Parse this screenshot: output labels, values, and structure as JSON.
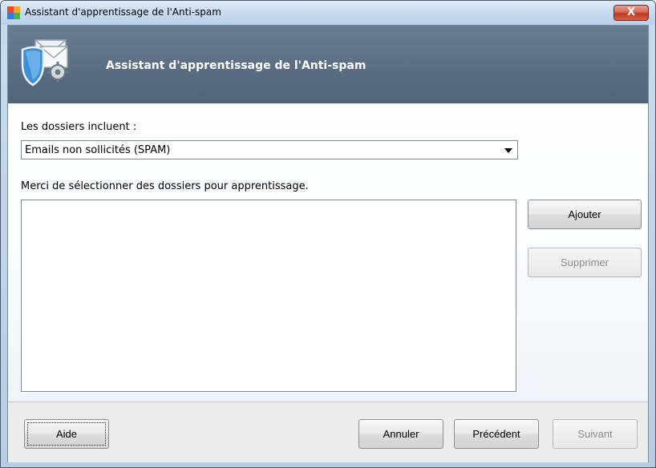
{
  "window": {
    "title": "Assistant d'apprentissage de l'Anti-spam",
    "close_label": "X"
  },
  "banner": {
    "title": "Assistant d'apprentissage de l'Anti-spam",
    "icon": "shield-envelope-gear-icon"
  },
  "folders": {
    "label": "Les dossiers incluent :",
    "selected": "Emails non sollicités (SPAM)"
  },
  "selection": {
    "label": "Merci de sélectionner des dossiers pour apprentissage.",
    "items": []
  },
  "buttons": {
    "add": "Ajouter",
    "remove": "Supprimer",
    "help": "Aide",
    "cancel": "Annuler",
    "previous": "Précédent",
    "next": "Suivant"
  },
  "colors": {
    "banner": "#5a6c82",
    "close_button": "#c0391e",
    "footer": "#ececec"
  }
}
